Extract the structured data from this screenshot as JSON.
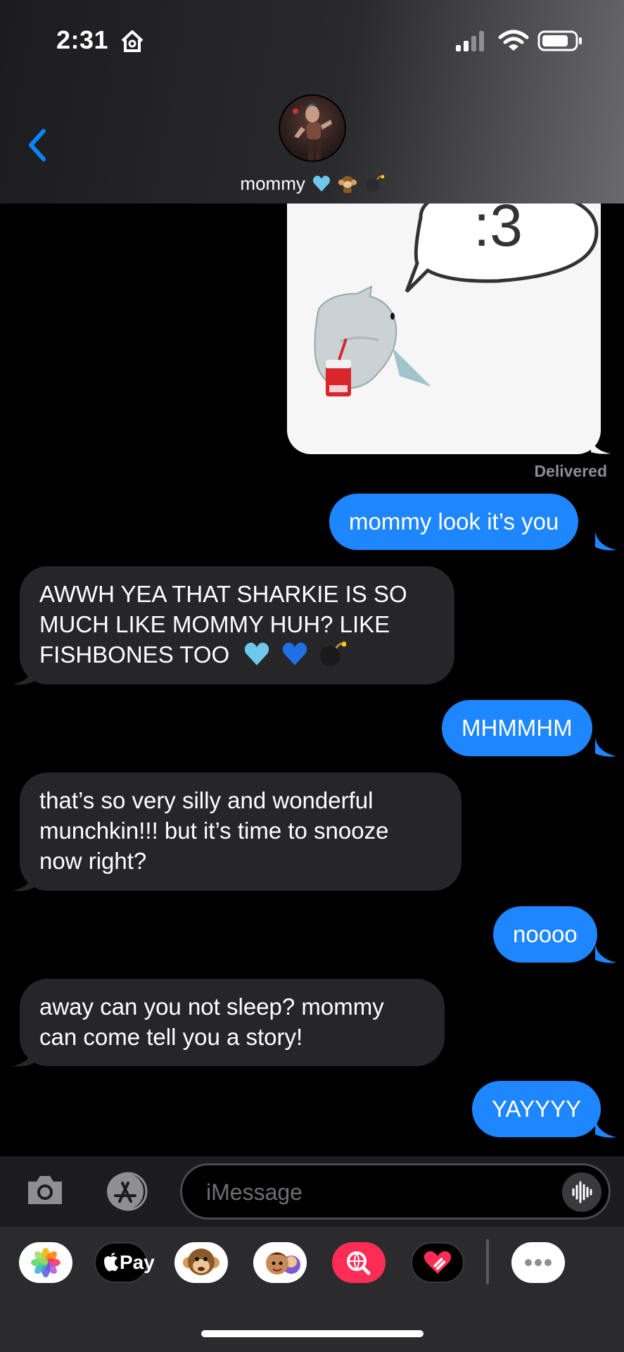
{
  "status_bar": {
    "time": "2:31"
  },
  "header": {
    "contact_name": "mommy"
  },
  "photo": {
    "speech_text": ":3",
    "status": "Delivered"
  },
  "messages": [
    {
      "from": "me",
      "text": "mommy look it’s you"
    },
    {
      "from": "them",
      "lines": [
        "AWWH YEA THAT SHARKIE IS SO",
        "MUCH LIKE MOMMY HUH? LIKE",
        "FISHBONES TOO"
      ]
    },
    {
      "from": "me",
      "text": "MHMMHM"
    },
    {
      "from": "them",
      "lines": [
        "that’s so very silly and wonderful",
        "munchkin!!! but it’s time to snooze",
        "now right?"
      ]
    },
    {
      "from": "me",
      "text": "noooo"
    },
    {
      "from": "them",
      "lines": [
        "away can you not sleep? mommy",
        "can come tell you a story!"
      ]
    },
    {
      "from": "me",
      "text": "YAYYYY"
    }
  ],
  "composer": {
    "placeholder": "iMessage"
  },
  "app_drawer": {
    "apple_pay_label": "Pay"
  },
  "colors": {
    "sent_bubble": "#1e86ff",
    "received_bubble": "#262628",
    "accent": "#0a84ff"
  },
  "icons": [
    "home-icon",
    "signal-icon",
    "wifi-icon",
    "battery-icon",
    "back-chevron-icon",
    "camera-icon",
    "app-store-icon",
    "audio-waveform-icon",
    "photos-icon",
    "apple-pay-icon",
    "memoji-monkey-icon",
    "memoji-stickers-icon",
    "image-search-icon",
    "digital-touch-icon",
    "more-icon"
  ]
}
